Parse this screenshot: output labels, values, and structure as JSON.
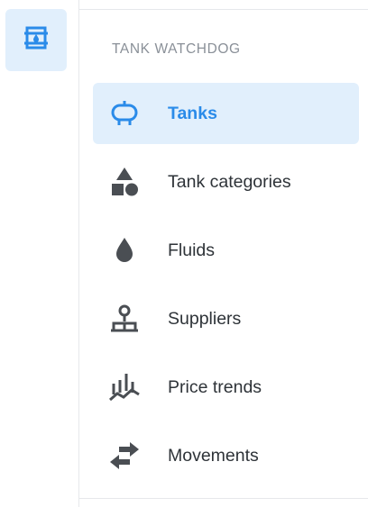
{
  "sidebar": {
    "rail": {
      "icon": "tank-fluid-icon"
    },
    "section_title": "TANK WATCHDOG",
    "active_color": "#2a8be9",
    "items": [
      {
        "label": "Tanks",
        "icon": "tank-icon",
        "active": true
      },
      {
        "label": "Tank categories",
        "icon": "shapes-icon",
        "active": false
      },
      {
        "label": "Fluids",
        "icon": "droplet-icon",
        "active": false
      },
      {
        "label": "Suppliers",
        "icon": "supplier-icon",
        "active": false
      },
      {
        "label": "Price trends",
        "icon": "price-trend-icon",
        "active": false
      },
      {
        "label": "Movements",
        "icon": "arrows-exchange-icon",
        "active": false
      }
    ]
  }
}
